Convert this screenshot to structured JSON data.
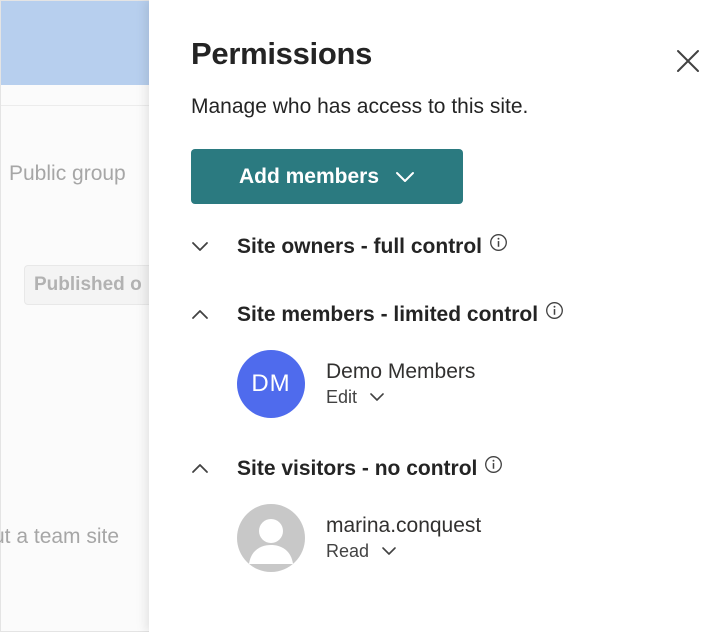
{
  "background": {
    "group_text": "Public group",
    "published_text": "Published o",
    "team_text": "ut a team site"
  },
  "panel": {
    "title": "Permissions",
    "description": "Manage who has access to this site.",
    "add_members_label": "Add members",
    "accent_color": "#2b7a80"
  },
  "sections": [
    {
      "title": "Site owners - full control",
      "expanded": false,
      "members": []
    },
    {
      "title": "Site members - limited control",
      "expanded": true,
      "members": [
        {
          "name": "Demo Members",
          "initials": "DM",
          "role": "Edit",
          "avatar_color": "#4f6bed"
        }
      ]
    },
    {
      "title": "Site visitors - no control",
      "expanded": true,
      "members": [
        {
          "name": "marina.conquest",
          "role": "Read",
          "avatar": "person-icon"
        }
      ]
    }
  ]
}
